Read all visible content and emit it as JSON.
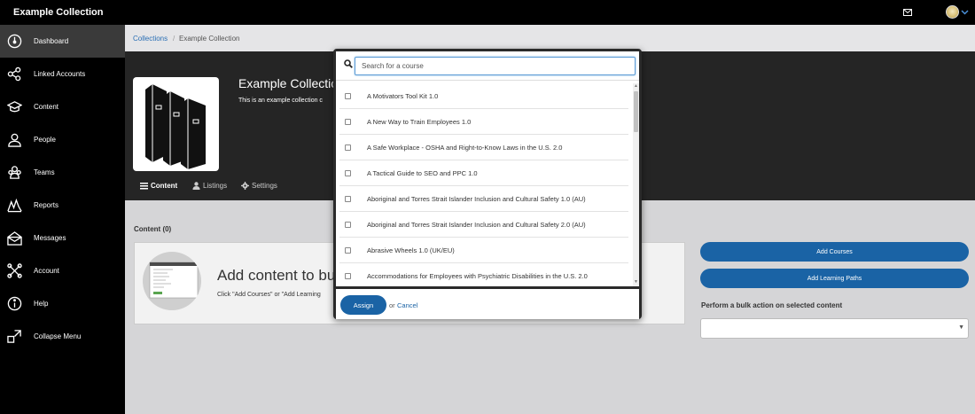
{
  "app": {
    "title": "Example Collection"
  },
  "header": {
    "mail_icon": "mail-icon",
    "avatar_icon": "avatar",
    "chevron_icon": "chevron-down-icon"
  },
  "sidebar": {
    "items": [
      {
        "label": "Dashboard",
        "icon": "dashboard-icon"
      },
      {
        "label": "Linked Accounts",
        "icon": "share-icon"
      },
      {
        "label": "Content",
        "icon": "graduation-cap-icon"
      },
      {
        "label": "People",
        "icon": "person-icon"
      },
      {
        "label": "Teams",
        "icon": "team-icon"
      },
      {
        "label": "Reports",
        "icon": "chart-icon"
      },
      {
        "label": "Messages",
        "icon": "envelope-open-icon"
      },
      {
        "label": "Account",
        "icon": "tools-icon"
      },
      {
        "label": "Help",
        "icon": "info-icon"
      },
      {
        "label": "Collapse Menu",
        "icon": "collapse-icon"
      }
    ]
  },
  "breadcrumb": {
    "link": "Collections",
    "separator": "/",
    "current": "Example Collection"
  },
  "collection": {
    "title": "Example Collectio",
    "description": "This is an example collection c",
    "tabs": [
      {
        "label": "Content",
        "icon": "list-icon"
      },
      {
        "label": "Listings",
        "icon": "user-icon"
      },
      {
        "label": "Settings",
        "icon": "gear-icon"
      }
    ]
  },
  "content_section": {
    "label": "Content (0)",
    "empty_title": "Add content to bu",
    "empty_sub": "Click \"Add Courses\" or \"Add Learning"
  },
  "actions": {
    "add_courses": "Add Courses",
    "add_learning_paths": "Add Learning Paths",
    "bulk_label": "Perform a bulk action on selected content",
    "bulk_value": ""
  },
  "modal": {
    "search_placeholder": "Search for a course",
    "courses": [
      "A Motivators Tool Kit 1.0",
      "A New Way to Train Employees 1.0",
      "A Safe Workplace - OSHA and Right-to-Know Laws in the U.S. 2.0",
      "A Tactical Guide to SEO and PPC 1.0",
      "Aboriginal and Torres Strait Islander Inclusion and Cultural Safety 1.0 (AU)",
      "Aboriginal and Torres Strait Islander Inclusion and Cultural Safety 2.0 (AU)",
      "Abrasive Wheels 1.0 (UK/EU)",
      "Accommodations for Employees with Psychiatric Disabilities in the U.S. 2.0"
    ],
    "assign_label": "Assign",
    "or_text": "or",
    "cancel_label": "Cancel"
  }
}
